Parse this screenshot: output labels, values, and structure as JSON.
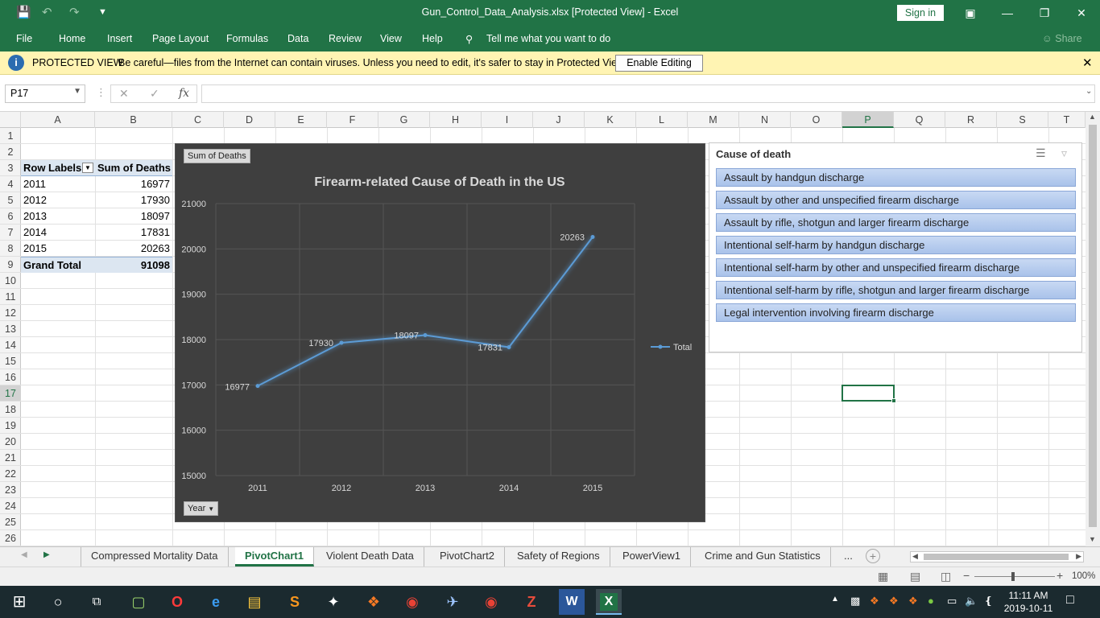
{
  "window": {
    "title": "Gun_Control_Data_Analysis.xlsx  [Protected View]  -  Excel",
    "sign_in": "Sign in"
  },
  "ribbon": {
    "tabs": [
      "File",
      "Home",
      "Insert",
      "Page Layout",
      "Formulas",
      "Data",
      "Review",
      "View",
      "Help"
    ],
    "tell_me": "Tell me what you want to do",
    "share": "Share"
  },
  "protected_view": {
    "title": "PROTECTED VIEW",
    "message": "Be careful—files from the Internet can contain viruses. Unless you need to edit, it's safer to stay in Protected View.",
    "enable_button": "Enable Editing"
  },
  "formula_bar": {
    "name_box": "P17",
    "fx": "fx",
    "value": ""
  },
  "columns": [
    "A",
    "B",
    "C",
    "D",
    "E",
    "F",
    "G",
    "H",
    "I",
    "J",
    "K",
    "L",
    "M",
    "N",
    "O",
    "P",
    "Q",
    "R",
    "S",
    "T"
  ],
  "rows": [
    "1",
    "2",
    "3",
    "4",
    "5",
    "6",
    "7",
    "8",
    "9",
    "10",
    "11",
    "12",
    "13",
    "14",
    "15",
    "16",
    "17",
    "18",
    "19",
    "20",
    "21",
    "22",
    "23",
    "24",
    "25",
    "26"
  ],
  "pivot": {
    "header_row_labels": "Row Labels",
    "header_sum": "Sum of Deaths",
    "rows": [
      {
        "year": "2011",
        "value": "16977"
      },
      {
        "year": "2012",
        "value": "17930"
      },
      {
        "year": "2013",
        "value": "18097"
      },
      {
        "year": "2014",
        "value": "17831"
      },
      {
        "year": "2015",
        "value": "20263"
      }
    ],
    "grand_total_label": "Grand Total",
    "grand_total_value": "91098"
  },
  "chart_data": {
    "type": "line",
    "title": "Firearm-related Cause of Death in the US",
    "value_field_button": "Sum of Deaths",
    "axis_field_button": "Year",
    "categories": [
      "2011",
      "2012",
      "2013",
      "2014",
      "2015"
    ],
    "series": [
      {
        "name": "Total",
        "values": [
          16977,
          17930,
          18097,
          17831,
          20263
        ]
      }
    ],
    "ylim": [
      15000,
      21000
    ],
    "yticks": [
      15000,
      16000,
      17000,
      18000,
      19000,
      20000,
      21000
    ],
    "grid": true,
    "legend": "right",
    "line_color": "#5b9bd5"
  },
  "slicer": {
    "title": "Cause of death",
    "items": [
      "Assault by handgun discharge",
      "Assault by other and unspecified firearm discharge",
      "Assault by rifle, shotgun and larger firearm discharge",
      "Intentional self-harm by handgun discharge",
      "Intentional self-harm by other and unspecified firearm discharge",
      "Intentional self-harm by rifle, shotgun and larger firearm discharge",
      "Legal intervention involving firearm discharge"
    ]
  },
  "sheet_tabs": [
    "Compressed Mortality Data",
    "PivotChart1",
    "Violent Death Data",
    "PivotChart2",
    "Safety of Regions",
    "PowerView1",
    "Crime and Gun Statistics"
  ],
  "active_sheet": "PivotChart1",
  "more_tabs": "...",
  "status": {
    "zoom": "100%"
  },
  "taskbar": {
    "time": "11:11 AM",
    "date": "2019-10-11"
  }
}
